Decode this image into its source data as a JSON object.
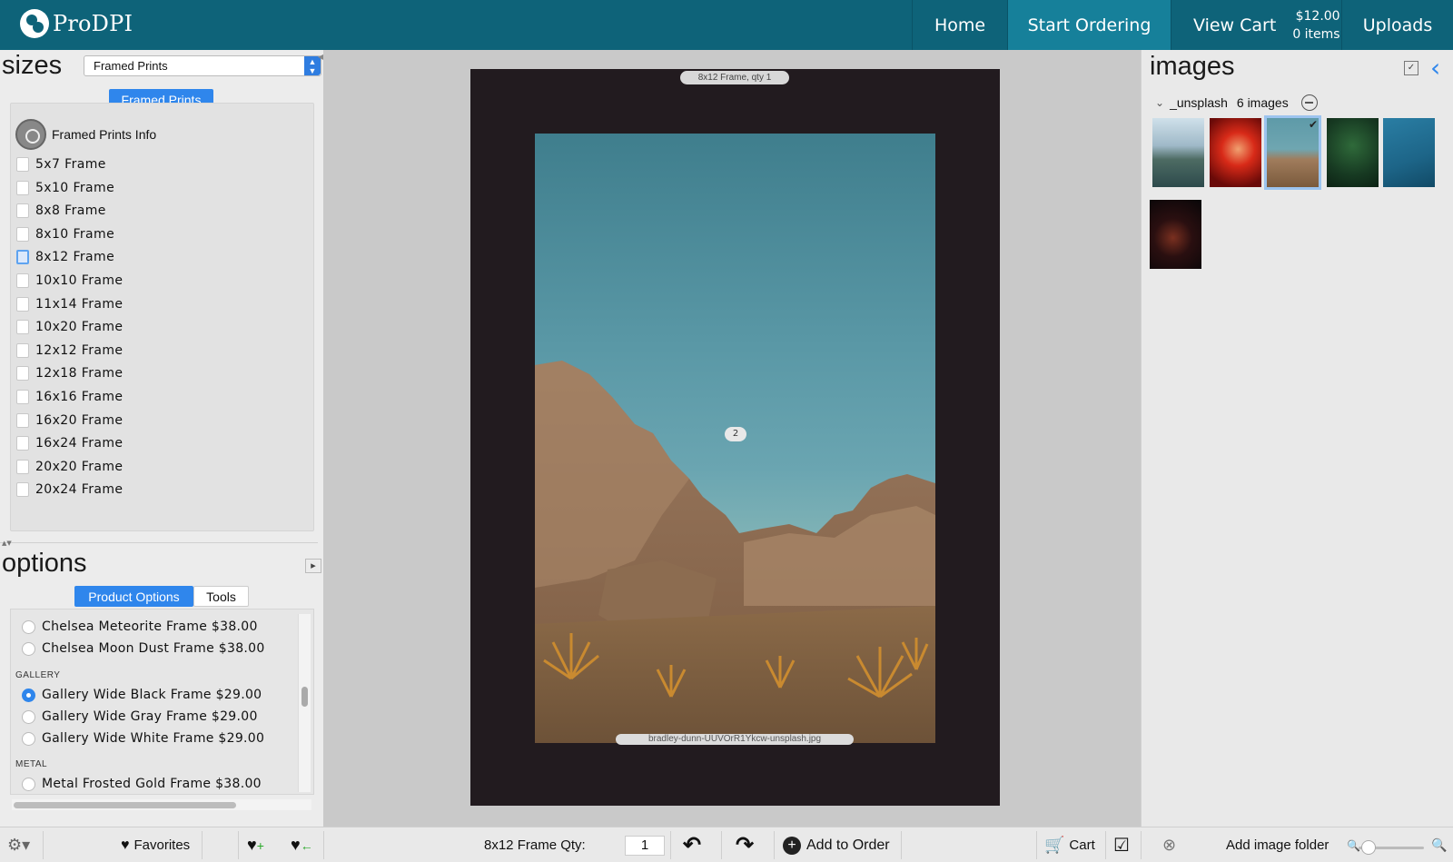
{
  "header": {
    "logo_text": "ProDPI",
    "nav": {
      "home": "Home",
      "start_ordering": "Start Ordering",
      "view_cart": "View Cart",
      "cart_total": "$12.00",
      "cart_items": "0 items",
      "uploads": "Uploads"
    }
  },
  "sizes_panel": {
    "title": "sizes",
    "category_select": "Framed Prints",
    "category_button": "Framed Prints",
    "info_label": "Framed Prints Info",
    "items": [
      {
        "label": "5x7 Frame"
      },
      {
        "label": "5x10 Frame"
      },
      {
        "label": "8x8 Frame"
      },
      {
        "label": "8x10 Frame"
      },
      {
        "label": "8x12 Frame",
        "selected": true
      },
      {
        "label": "10x10 Frame"
      },
      {
        "label": "11x14 Frame"
      },
      {
        "label": "10x20 Frame"
      },
      {
        "label": "12x12 Frame"
      },
      {
        "label": "12x18 Frame"
      },
      {
        "label": "16x16 Frame"
      },
      {
        "label": "16x20 Frame"
      },
      {
        "label": "16x24 Frame"
      },
      {
        "label": "20x20 Frame"
      },
      {
        "label": "20x24 Frame"
      }
    ]
  },
  "options_panel": {
    "title": "options",
    "tab_product_options": "Product Options",
    "tab_tools": "Tools",
    "options": [
      {
        "label": "Chelsea Meteorite Frame $38.00"
      },
      {
        "label": "Chelsea Moon Dust Frame $38.00"
      },
      {
        "group": "GALLERY"
      },
      {
        "label": "Gallery Wide Black Frame $29.00",
        "selected": true
      },
      {
        "label": "Gallery Wide Gray Frame $29.00"
      },
      {
        "label": "Gallery Wide White Frame $29.00"
      },
      {
        "group": "METAL"
      },
      {
        "label": "Metal Frosted Gold Frame $38.00"
      }
    ]
  },
  "preview": {
    "frame_label": "8x12 Frame, qty 1",
    "page_badge": "2",
    "filename": "bradley-dunn-UUVOrR1Ykcw-unsplash.jpg"
  },
  "images_panel": {
    "title": "images",
    "folder_name": "_unsplash",
    "folder_count": "6 images",
    "thumbs": [
      {
        "name": "lake-mountains",
        "selected": false
      },
      {
        "name": "red-light-portrait",
        "selected": false
      },
      {
        "name": "desert-rocks",
        "selected": true
      },
      {
        "name": "green-fern",
        "selected": false
      },
      {
        "name": "hand-mirror",
        "selected": false
      },
      {
        "name": "dark-room",
        "selected": false
      }
    ]
  },
  "bottombar": {
    "favorites": "Favorites",
    "qty_label": "8x12 Frame Qty:",
    "qty_value": "1",
    "add_to_order": "Add to Order",
    "cart": "Cart",
    "add_image_folder": "Add image folder"
  },
  "colors": {
    "header_bg": "#0e6379",
    "header_active": "#16809a",
    "accent_blue": "#2f86ec",
    "frame_color": "#221b1f"
  }
}
